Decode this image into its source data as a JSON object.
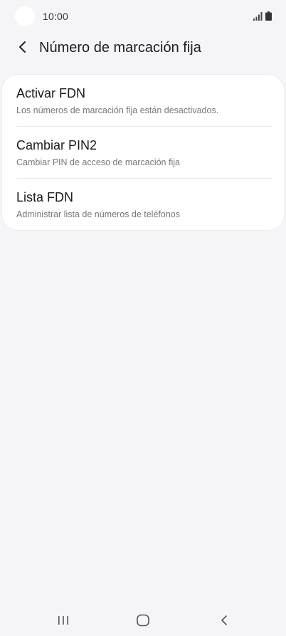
{
  "status_bar": {
    "time": "10:00",
    "icons": [
      "signal-icon",
      "battery-icon"
    ]
  },
  "header": {
    "back_icon": "chevron-left-icon",
    "title": "Número de marcación fija"
  },
  "menu": {
    "items": [
      {
        "title": "Activar FDN",
        "subtitle": "Los números de marcación fija están desactivados."
      },
      {
        "title": "Cambiar PIN2",
        "subtitle": "Cambiar PIN de acceso de marcación fija"
      },
      {
        "title": "Lista FDN",
        "subtitle": "Administrar lista de números de teléfonos"
      }
    ]
  },
  "nav_bar": {
    "buttons": [
      "recent-apps-icon",
      "home-icon",
      "back-icon"
    ]
  },
  "colors": {
    "background": "#f5f5f7",
    "card": "#ffffff",
    "subtitle": "#777777"
  }
}
